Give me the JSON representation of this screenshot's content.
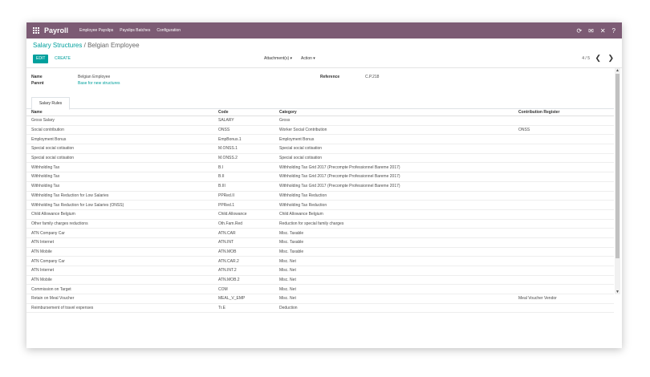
{
  "topbar": {
    "app_name": "Payroll",
    "menu": [
      "Employee Payslips",
      "Payslips Batches",
      "Configuration"
    ],
    "icons": [
      "refresh-icon",
      "chat-icon",
      "close-icon",
      "help-icon"
    ],
    "icon_glyphs": [
      "⟳",
      "✉",
      "✕",
      "?"
    ]
  },
  "breadcrumb": {
    "parent": "Salary Structures",
    "sep": "/",
    "current": "Belgian Employee"
  },
  "buttons": {
    "edit": "EDIT",
    "create": "CREATE",
    "attachments": "Attachment(s) ▾",
    "action": "Action ▾"
  },
  "pager": {
    "value": "4 / 5",
    "prev": "❮",
    "next": "❯"
  },
  "form": {
    "name_label": "Name",
    "name_value": "Belgian Employee",
    "parent_label": "Parent",
    "parent_value": "Base for new structures",
    "reference_label": "Reference",
    "reference_value": "C.P.218"
  },
  "tab": "Salary Rules",
  "table": {
    "columns": [
      "Name",
      "Code",
      "Category",
      "Contribution Register"
    ],
    "rows": [
      [
        "Gross Salary",
        "SALARY",
        "Gross",
        ""
      ],
      [
        "Social contribution",
        "ONSS",
        "Worker Social Contribution",
        "ONSS"
      ],
      [
        "Employment Bonus",
        "EmpBonus.1",
        "Employment Bonus",
        ""
      ],
      [
        "Special social cotisation",
        "M.ONSS.1",
        "Special social cotisation",
        ""
      ],
      [
        "Special social cotisation",
        "M.ONSS.2",
        "Special social cotisation",
        ""
      ],
      [
        "Withholding Tax",
        "B.I",
        "Withholding Tax Grid 2017 (Precompte Professionnel Bareme 2017)",
        ""
      ],
      [
        "Withholding Tax",
        "B.II",
        "Withholding Tax Grid 2017 (Precompte Professionnel Bareme 2017)",
        ""
      ],
      [
        "Withholding Tax",
        "B.III",
        "Withholding Tax Grid 2017 (Precompte Professionnel Bareme 2017)",
        ""
      ],
      [
        "Withholding Tax Reduction for Low Salaries",
        "PPRed.II",
        "Withholding Tax Reduction",
        ""
      ],
      [
        "Withholding Tax Reduction for Low Salaries (ONSS)",
        "PPRed.1",
        "Withholding Tax Reduction",
        ""
      ],
      [
        "Child Allowance Belgium",
        "Child.Allowance",
        "Child Allowance Belgium",
        ""
      ],
      [
        "Other family charges reductions",
        "Oth.Fam.Red",
        "Reduction for special family charges",
        ""
      ],
      [
        "ATN Company Car",
        "ATN.CAR",
        "Misc. Taxable",
        ""
      ],
      [
        "ATN Internet",
        "ATN.INT",
        "Misc. Taxable",
        ""
      ],
      [
        "ATN Mobile",
        "ATN.MOB",
        "Misc. Taxable",
        ""
      ],
      [
        "ATN Company Car",
        "ATN.CAR.2",
        "Misc. Net",
        ""
      ],
      [
        "ATN Internet",
        "ATN.INT.2",
        "Misc. Net",
        ""
      ],
      [
        "ATN Mobile",
        "ATN.MOB.2",
        "Misc. Net",
        ""
      ],
      [
        "Commission on Target",
        "COM",
        "Misc. Net",
        ""
      ],
      [
        "Retain on Meal Voucher",
        "MEAL_V_EMP",
        "Misc. Net",
        "Meal Voucher Vendor"
      ],
      [
        "Reimbursement of travel expenses",
        "Tr.E",
        "Deduction",
        ""
      ]
    ]
  }
}
